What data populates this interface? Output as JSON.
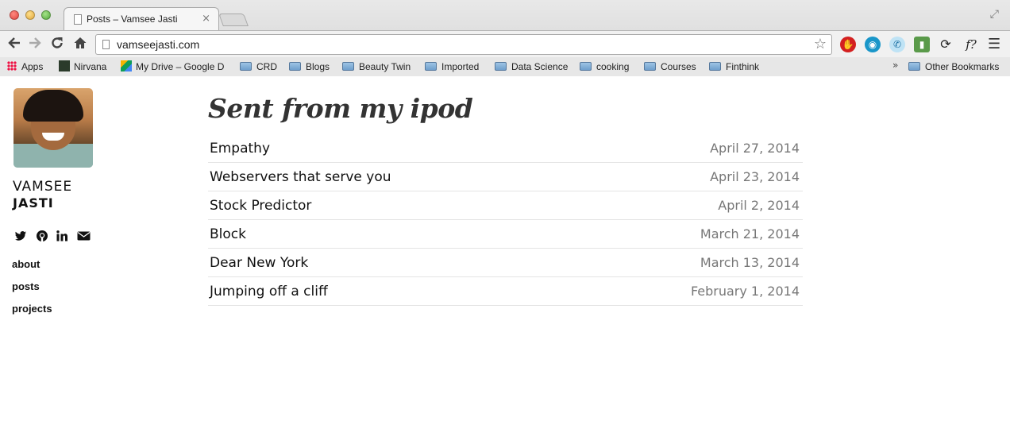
{
  "browser": {
    "tab_title": "Posts – Vamsee Jasti",
    "tab_close": "×",
    "url": "vamseejasti.com",
    "ext_icons": [
      "adblock-icon",
      "camera-icon",
      "phone-icon",
      "book-icon",
      "sync-icon",
      "formula-icon"
    ],
    "ext_formula_label": "f?",
    "bookmarks": [
      {
        "label": "Apps",
        "icon": "apps-grid-icon"
      },
      {
        "label": "Nirvana",
        "icon": "nirvana-icon"
      },
      {
        "label": "My Drive – Google D",
        "icon": "google-drive-icon"
      },
      {
        "label": "CRD",
        "icon": "folder-icon"
      },
      {
        "label": "Blogs",
        "icon": "folder-icon"
      },
      {
        "label": "Beauty Twin",
        "icon": "folder-icon"
      },
      {
        "label": "Imported",
        "icon": "folder-icon"
      },
      {
        "label": "Data Science",
        "icon": "folder-icon"
      },
      {
        "label": "cooking",
        "icon": "folder-icon"
      },
      {
        "label": "Courses",
        "icon": "folder-icon"
      },
      {
        "label": "Finthink",
        "icon": "folder-icon"
      }
    ],
    "bookmarks_overflow": "»",
    "other_bookmarks": "Other Bookmarks"
  },
  "profile": {
    "first_name": "VAMSEE",
    "last_name": "JASTI",
    "social": [
      "twitter-icon",
      "github-icon",
      "linkedin-icon",
      "mail-icon"
    ]
  },
  "nav": {
    "about": "about",
    "posts": "posts",
    "projects": "projects"
  },
  "main": {
    "title": "Sent from my ipod",
    "posts": [
      {
        "title": "Empathy",
        "date": "April 27, 2014"
      },
      {
        "title": "Webservers that serve you",
        "date": "April 23, 2014"
      },
      {
        "title": "Stock Predictor",
        "date": "April 2, 2014"
      },
      {
        "title": "Block",
        "date": "March 21, 2014"
      },
      {
        "title": "Dear New York",
        "date": "March 13, 2014"
      },
      {
        "title": "Jumping off a cliff",
        "date": "February 1, 2014"
      }
    ]
  }
}
